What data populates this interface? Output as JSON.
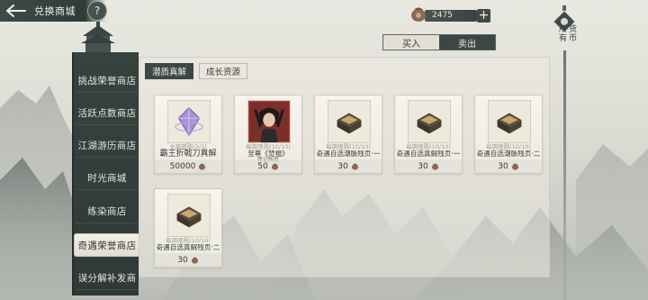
{
  "header": {
    "title": "兑换商城",
    "help_label": "?"
  },
  "currency": {
    "amount": "2475",
    "add_label": "+"
  },
  "trade_tabs": [
    {
      "label": "买入",
      "active": true
    },
    {
      "label": "卖出",
      "active": false
    }
  ],
  "right_shortcut": {
    "label_col1": "所有",
    "label_col2": "货币"
  },
  "side_menu": [
    {
      "label": "挑战荣誉商店",
      "active": false
    },
    {
      "label": "活跃点数商店",
      "active": false
    },
    {
      "label": "江湖游历商店",
      "active": false
    },
    {
      "label": "时光商城",
      "active": false
    },
    {
      "label": "练染商店",
      "active": false
    },
    {
      "label": "奇遇荣誉商店",
      "active": true
    },
    {
      "label": "误分解补发商",
      "active": false
    }
  ],
  "sub_tabs": [
    {
      "label": "潜质真解",
      "active": true
    },
    {
      "label": "成长资源",
      "active": false
    }
  ],
  "items": [
    {
      "limit": "全服限购(2/3)",
      "name": "霸王折戟刀真解",
      "sub": "",
      "price": "50000",
      "icon": "purple-crystal-icon"
    },
    {
      "limit": "每周限购(10/10)",
      "name": "至尊《焚棍》",
      "sub": "传记残页",
      "price": "50",
      "icon": "swordsman-portrait-icon"
    },
    {
      "limit": "每周限购(10/10)",
      "name": "奇遇自选潮脉残页·一",
      "sub": "",
      "price": "30",
      "icon": "book-chest-icon"
    },
    {
      "limit": "每周限购(10/10)",
      "name": "奇遇自选真解残页·一",
      "sub": "",
      "price": "30",
      "icon": "book-chest-icon"
    },
    {
      "limit": "每周限购(10/10)",
      "name": "奇遇自选潮脉残页·二",
      "sub": "",
      "price": "30",
      "icon": "book-chest-icon"
    },
    {
      "limit": "每周限购(10/10)",
      "name": "奇遇自选真解残页·二",
      "sub": "",
      "price": "30",
      "icon": "book-chest-icon"
    }
  ]
}
